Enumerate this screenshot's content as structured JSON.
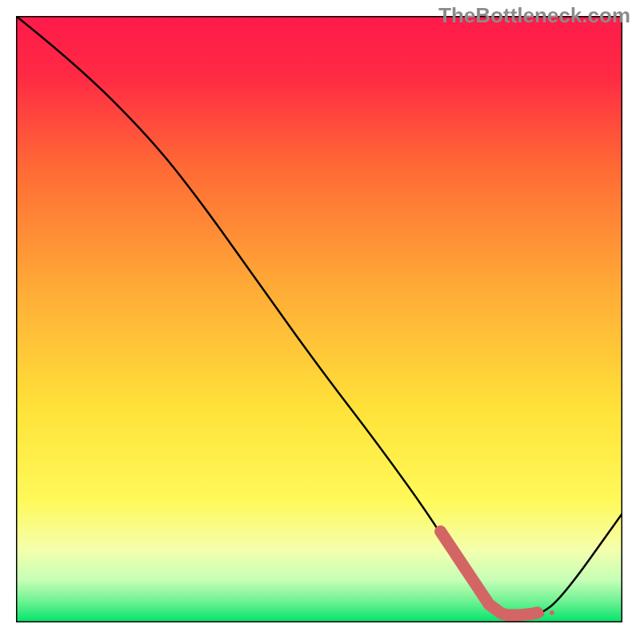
{
  "watermark": "TheBottleneck.com",
  "colors": {
    "gradient_top": "#ff1a4a",
    "gradient_upper": "#ff5a39",
    "gradient_mid": "#ffb437",
    "gradient_yellow": "#ffef3a",
    "gradient_pale": "#fbffb0",
    "gradient_green_light": "#9cf7a8",
    "gradient_green": "#00e46a",
    "curve_stroke": "#000000",
    "marker_stroke": "#d46565",
    "plot_border": "#000000"
  },
  "chart_data": {
    "type": "line",
    "title": "",
    "xlabel": "",
    "ylabel": "",
    "xlim": [
      0,
      100
    ],
    "ylim": [
      0,
      100
    ],
    "series": [
      {
        "name": "bottleneck-curve",
        "x": [
          0,
          10,
          22,
          30,
          40,
          50,
          60,
          70,
          75,
          78,
          82,
          86,
          90,
          100
        ],
        "y": [
          100,
          92,
          80,
          70,
          56,
          42,
          29,
          15,
          6,
          2,
          1,
          1,
          4,
          18
        ]
      }
    ],
    "annotations": [
      {
        "name": "highlight-segment",
        "type": "polyline-marker",
        "x": [
          70,
          72,
          74,
          76,
          78,
          80,
          81,
          83,
          85,
          86
        ],
        "y": [
          15,
          12,
          9,
          6,
          3,
          1.5,
          1.2,
          1.2,
          1.4,
          1.6
        ]
      }
    ]
  }
}
